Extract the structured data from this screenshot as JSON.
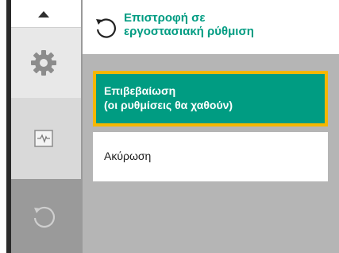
{
  "header": {
    "title_line1": "Επιστροφή σε",
    "title_line2": "εργοστασιακή ρύθμιση",
    "icon": "reset-icon",
    "accent_color": "#009c82"
  },
  "options": {
    "confirm_line1": "Επιβεβαίωση",
    "confirm_line2": "(οι ρυθμίσεις θα χαθούν)",
    "cancel_label": "Ακύρωση",
    "focus_color": "#f5b700"
  },
  "rail": {
    "items": [
      "settings-icon",
      "diagnostics-icon",
      "reset-icon"
    ]
  }
}
